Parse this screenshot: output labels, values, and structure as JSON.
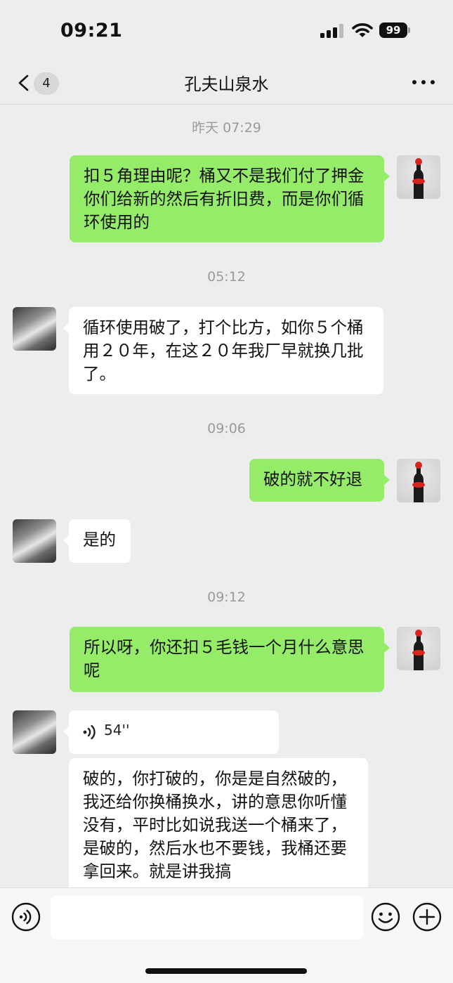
{
  "status_bar": {
    "time": "09:21",
    "battery": "99"
  },
  "nav": {
    "unread_count": "4",
    "title": "孔夫山泉水"
  },
  "messages": [
    {
      "timestamp": "昨天 07:29"
    },
    {
      "side": "mine",
      "text": "扣５角理由呢？桶又不是我们付了押金你们给新的然后有折旧费，而是你们循环使用的"
    },
    {
      "timestamp": "05:12"
    },
    {
      "side": "theirs",
      "text": "循环使用破了，打个比方，如你５个桶用２０年，在这２０年我厂早就换几批了。"
    },
    {
      "timestamp": "09:06"
    },
    {
      "side": "mine",
      "text": "破的就不好退"
    },
    {
      "side": "theirs",
      "text": "是的"
    },
    {
      "timestamp": "09:12"
    },
    {
      "side": "mine",
      "text": "所以呀，你还扣５毛钱一个月什么意思呢"
    },
    {
      "side": "theirs",
      "type": "voice",
      "duration": "54''"
    },
    {
      "side": "theirs",
      "type": "transcript",
      "text": "破的，你打破的，你是是自然破的，我还给你换桶换水，讲的意思你听懂没有，平时比如说我送一个桶来了，是破的，然后水也不要钱，我桶还要拿回来。就是讲我搞"
    }
  ],
  "input": {
    "placeholder": ""
  },
  "colors": {
    "mine_bubble": "#95ec69",
    "theirs_bubble": "#ffffff",
    "background": "#ededed"
  },
  "icons": [
    "signal-icon",
    "wifi-icon",
    "battery-icon",
    "back-chevron-icon",
    "more-icon",
    "voice-wave-icon",
    "voice-mode-icon",
    "emoji-icon",
    "plus-icon"
  ]
}
